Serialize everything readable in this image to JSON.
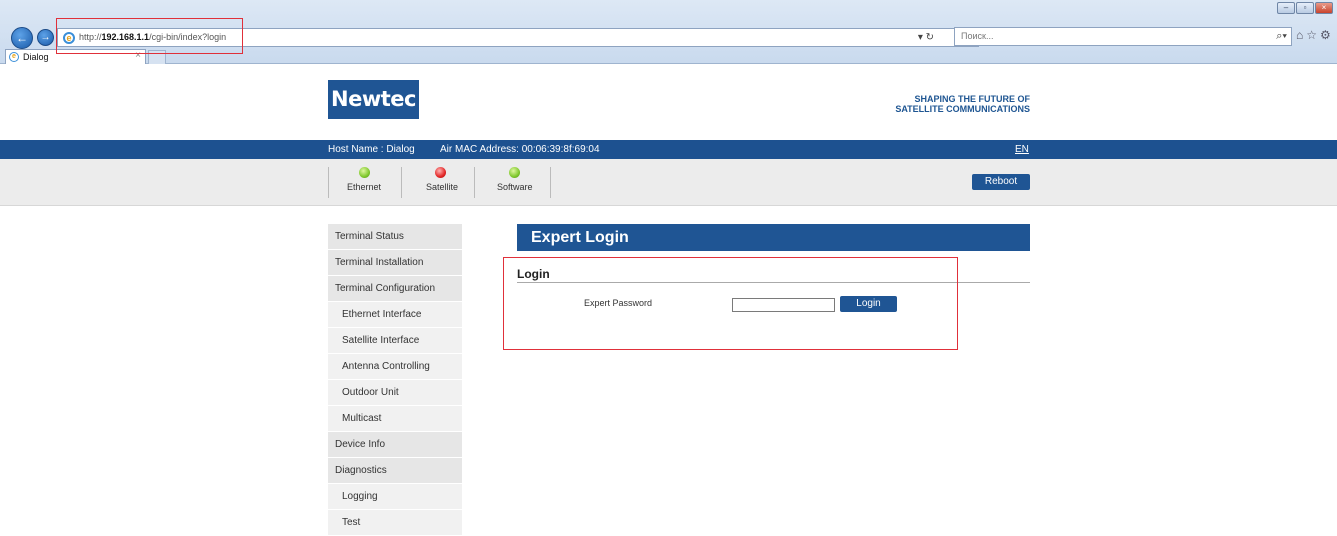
{
  "browser": {
    "url_prefix": "http://",
    "url_host": "192.168.1.1",
    "url_path": "/cgi-bin/index?login",
    "search_placeholder": "Поиск...",
    "tab_title": "Dialog",
    "tab_close": "×",
    "refresh_icons": "▾ ↻",
    "right_icons": "⌂☆⚙",
    "back_glyph": "←",
    "forward_glyph": "→",
    "search_glyph": "⌕▾",
    "window_buttons": [
      "–",
      "▫",
      "×"
    ]
  },
  "header": {
    "logo": "Newtec",
    "tagline_line1": "SHAPING THE FUTURE OF",
    "tagline_line2": "SATELLITE COMMUNICATIONS"
  },
  "hostbar": {
    "host_name": "Host Name : Dialog",
    "mac_address": "Air MAC Address:  00:06:39:8f:69:04",
    "language": "EN"
  },
  "status": {
    "indicators": [
      {
        "label": "Ethernet",
        "state": "green"
      },
      {
        "label": "Satellite",
        "state": "red"
      },
      {
        "label": "Software",
        "state": "green"
      }
    ],
    "reboot_label": "Reboot"
  },
  "sidebar": {
    "items": [
      {
        "label": "Terminal Status",
        "sub": false
      },
      {
        "label": "Terminal Installation",
        "sub": false
      },
      {
        "label": "Terminal Configuration",
        "sub": false
      },
      {
        "label": "Ethernet Interface",
        "sub": true
      },
      {
        "label": "Satellite Interface",
        "sub": true
      },
      {
        "label": "Antenna Controlling",
        "sub": true
      },
      {
        "label": "Outdoor Unit",
        "sub": true
      },
      {
        "label": "Multicast",
        "sub": true
      },
      {
        "label": "Device Info",
        "sub": false
      },
      {
        "label": "Diagnostics",
        "sub": false
      },
      {
        "label": "Logging",
        "sub": true
      },
      {
        "label": "Test",
        "sub": true
      }
    ]
  },
  "main": {
    "title": "Expert Login",
    "section_title": "Login",
    "password_label": "Expert Password",
    "password_value": "",
    "login_label": "Login"
  },
  "colors": {
    "brand_blue": "#1f5594",
    "highlight_red": "#e0303a"
  }
}
